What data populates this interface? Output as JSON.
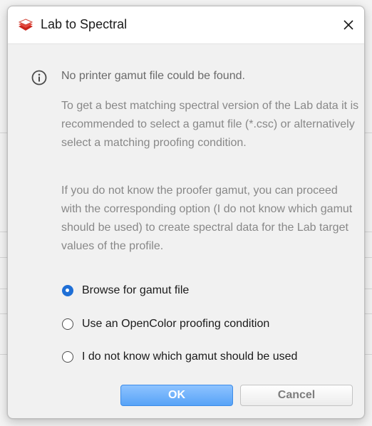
{
  "dialog": {
    "title": "Lab to Spectral",
    "close_icon": "close-icon",
    "app_icon": "lab-to-spectral-app-icon",
    "info_icon": "info-icon",
    "headline": "No printer gamut file could be found.",
    "paragraph1": "To get a best matching spectral version of the Lab data it is recommended to select a gamut file (*.csc) or alternatively select a matching proofing condition.",
    "paragraph2": "If you do not know the proofer gamut, you can proceed with the corresponding option (I do not know which gamut should be used) to create spectral data for the Lab target values of the profile.",
    "options": [
      {
        "label": "Browse for gamut file",
        "selected": true
      },
      {
        "label": "Use an OpenColor proofing condition",
        "selected": false
      },
      {
        "label": "I do not know which gamut should be used",
        "selected": false
      }
    ],
    "ok_label": "OK",
    "cancel_label": "Cancel",
    "colors": {
      "accent": "#1f6fd6",
      "ok_button": "#57a3f7",
      "text_muted": "#888888"
    }
  }
}
